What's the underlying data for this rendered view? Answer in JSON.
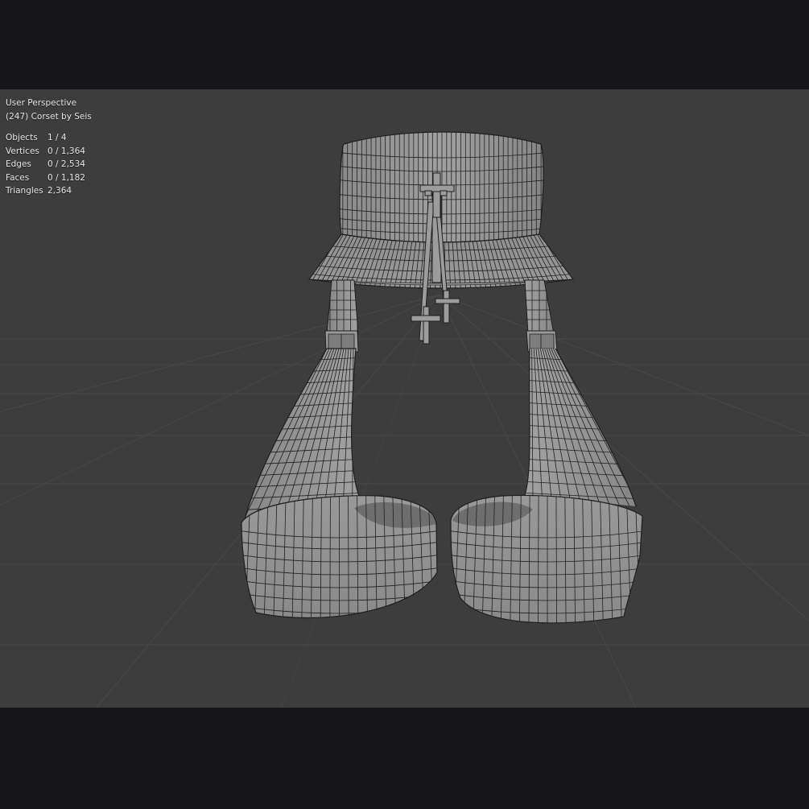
{
  "viewport": {
    "view_name": "User Perspective",
    "object_info": "(247) Corset by Seis"
  },
  "stats": [
    {
      "label": "Objects",
      "value": "1 / 4"
    },
    {
      "label": "Vertices",
      "value": "0 / 1,364"
    },
    {
      "label": "Edges",
      "value": "0 / 2,534"
    },
    {
      "label": "Faces",
      "value": "0 / 1,182"
    },
    {
      "label": "Triangles",
      "value": "2,364"
    }
  ],
  "colors": {
    "viewport_bg": "#3d3d3d",
    "letterbox": "#16161b",
    "mesh_fill": "#8e8e8e",
    "wire": "#1e1e1e",
    "grid": "#474747"
  }
}
